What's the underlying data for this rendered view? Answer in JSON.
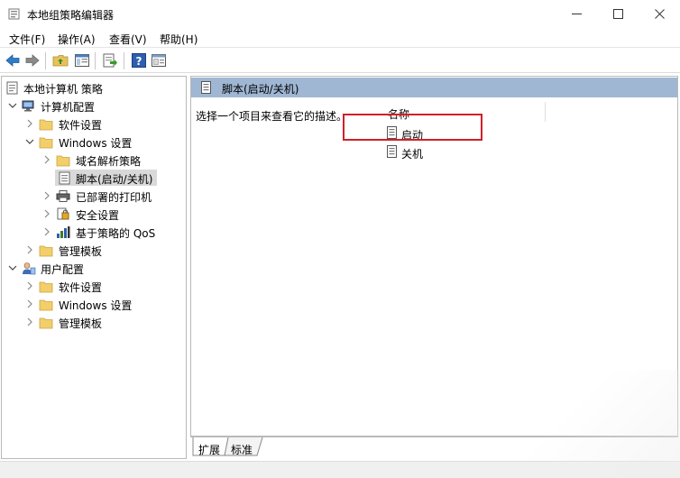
{
  "window": {
    "title": "本地组策略编辑器",
    "controls": [
      "minimize",
      "maximize",
      "close"
    ]
  },
  "menu": {
    "items": [
      "文件(F)",
      "操作(A)",
      "查看(V)",
      "帮助(H)"
    ]
  },
  "toolbar": {
    "buttons": [
      "back-icon",
      "forward-icon",
      "up-folder-icon",
      "show-tree-icon",
      "export-icon",
      "help-icon",
      "properties-icon"
    ]
  },
  "tree": {
    "root": "本地计算机 策略",
    "items": [
      {
        "label": "计算机配置",
        "expanded": true
      },
      {
        "label": "软件设置",
        "expanded": false
      },
      {
        "label": "Windows 设置",
        "expanded": true
      },
      {
        "label": "域名解析策略",
        "expanded": false
      },
      {
        "label": "脚本(启动/关机)",
        "selected": true
      },
      {
        "label": "已部署的打印机",
        "expanded": false
      },
      {
        "label": "安全设置",
        "expanded": false
      },
      {
        "label": "基于策略的 QoS",
        "expanded": false
      },
      {
        "label": "管理模板",
        "expanded": false
      },
      {
        "label": "用户配置",
        "expanded": true
      },
      {
        "label": "软件设置",
        "expanded": false
      },
      {
        "label": "Windows 设置",
        "expanded": false
      },
      {
        "label": "管理模板",
        "expanded": false
      }
    ]
  },
  "details": {
    "header_title": "脚本(启动/关机)",
    "description": "选择一个项目来查看它的描述。",
    "column_name": "名称",
    "items": [
      "启动",
      "关机"
    ]
  },
  "tabs": {
    "items": [
      "扩展",
      "标准"
    ],
    "active": "扩展"
  },
  "colors": {
    "header_bg": "#9fb7d3",
    "highlight_border": "#d0202a",
    "selected_bg": "#d9d9d9"
  }
}
